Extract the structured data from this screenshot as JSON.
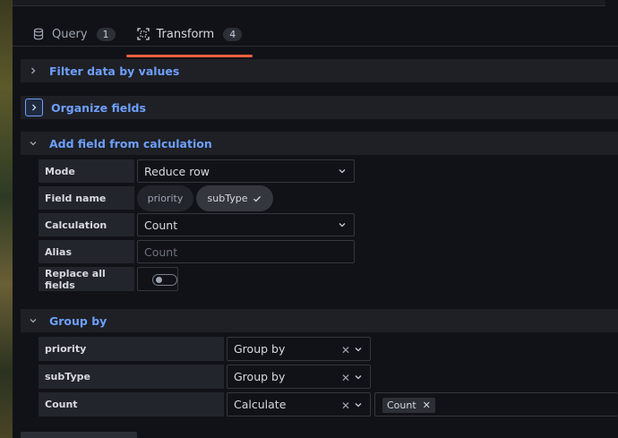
{
  "tabs": [
    {
      "label": "Query",
      "count": "1",
      "icon": "database-icon"
    },
    {
      "label": "Transform",
      "count": "4",
      "icon": "transform-icon"
    }
  ],
  "transforms": {
    "filter": {
      "title": "Filter data by values"
    },
    "organize": {
      "title": "Organize fields"
    },
    "calc": {
      "title": "Add field from calculation",
      "mode_label": "Mode",
      "mode_value": "Reduce row",
      "fieldname_label": "Field name",
      "field_pills": [
        {
          "label": "priority",
          "selected": false
        },
        {
          "label": "subType",
          "selected": true
        }
      ],
      "calculation_label": "Calculation",
      "calculation_value": "Count",
      "alias_label": "Alias",
      "alias_placeholder": "Count",
      "replace_label": "Replace all fields",
      "replace_on": false
    },
    "groupby": {
      "title": "Group by",
      "rows": [
        {
          "field": "priority",
          "value": "Group by"
        },
        {
          "field": "subType",
          "value": "Group by"
        },
        {
          "field": "Count",
          "value": "Calculate",
          "chips": [
            "Count"
          ]
        }
      ]
    }
  },
  "colors": {
    "accent_blue": "#6e9fff",
    "active_tab_underline": "#f55f3e"
  }
}
